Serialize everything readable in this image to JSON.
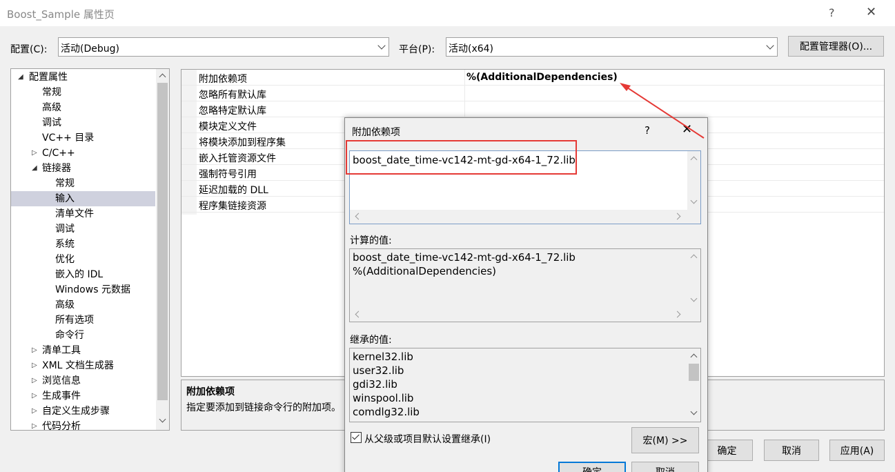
{
  "window": {
    "title": "Boost_Sample 属性页",
    "help": "?",
    "close": "✕"
  },
  "config": {
    "config_label": "配置(C):",
    "config_value": "活动(Debug)",
    "platform_label": "平台(P):",
    "platform_value": "活动(x64)",
    "manager_button": "配置管理器(O)..."
  },
  "tree": {
    "items": [
      {
        "label": "配置属性",
        "toggle": "◢"
      },
      {
        "label": "常规"
      },
      {
        "label": "高级"
      },
      {
        "label": "调试"
      },
      {
        "label": "VC++ 目录"
      },
      {
        "label": "C/C++",
        "toggle": "▷"
      },
      {
        "label": "链接器",
        "toggle": "◢"
      },
      {
        "label": "常规"
      },
      {
        "label": "输入"
      },
      {
        "label": "清单文件"
      },
      {
        "label": "调试"
      },
      {
        "label": "系统"
      },
      {
        "label": "优化"
      },
      {
        "label": "嵌入的 IDL"
      },
      {
        "label": "Windows 元数据"
      },
      {
        "label": "高级"
      },
      {
        "label": "所有选项"
      },
      {
        "label": "命令行"
      },
      {
        "label": "清单工具",
        "toggle": "▷"
      },
      {
        "label": "XML 文档生成器",
        "toggle": "▷"
      },
      {
        "label": "浏览信息",
        "toggle": "▷"
      },
      {
        "label": "生成事件",
        "toggle": "▷"
      },
      {
        "label": "自定义生成步骤",
        "toggle": "▷"
      },
      {
        "label": "代码分析",
        "toggle": "▷"
      }
    ]
  },
  "grid": {
    "rows": [
      {
        "name": "附加依赖项",
        "value": "%(AdditionalDependencies)"
      },
      {
        "name": "忽略所有默认库",
        "value": ""
      },
      {
        "name": "忽略特定默认库",
        "value": ""
      },
      {
        "name": "模块定义文件",
        "value": ""
      },
      {
        "name": "将模块添加到程序集",
        "value": ""
      },
      {
        "name": "嵌入托管资源文件",
        "value": ""
      },
      {
        "name": "强制符号引用",
        "value": ""
      },
      {
        "name": "延迟加载的 DLL",
        "value": ""
      },
      {
        "name": "程序集链接资源",
        "value": ""
      }
    ]
  },
  "description": {
    "title": "附加依赖项",
    "text": "指定要添加到链接命令行的附加项。"
  },
  "main_buttons": {
    "ok": "确定",
    "cancel": "取消",
    "apply": "应用(A)"
  },
  "dialog": {
    "title": "附加依赖项",
    "help": "?",
    "close": "✕",
    "edit_value": "boost_date_time-vc142-mt-gd-x64-1_72.lib",
    "computed_label": "计算的值:",
    "computed_lines": [
      "boost_date_time-vc142-mt-gd-x64-1_72.lib",
      "%(AdditionalDependencies)"
    ],
    "inherited_label": "继承的值:",
    "inherited_lines": [
      "kernel32.lib",
      "user32.lib",
      "gdi32.lib",
      "winspool.lib",
      "comdlg32.lib"
    ],
    "inherit_checkbox": "从父级或项目默认设置继承(I)",
    "inherit_checked": true,
    "macro_button": "宏(M) >>",
    "ok": "确定",
    "cancel": "取消"
  },
  "annotation_color": "#e53935"
}
